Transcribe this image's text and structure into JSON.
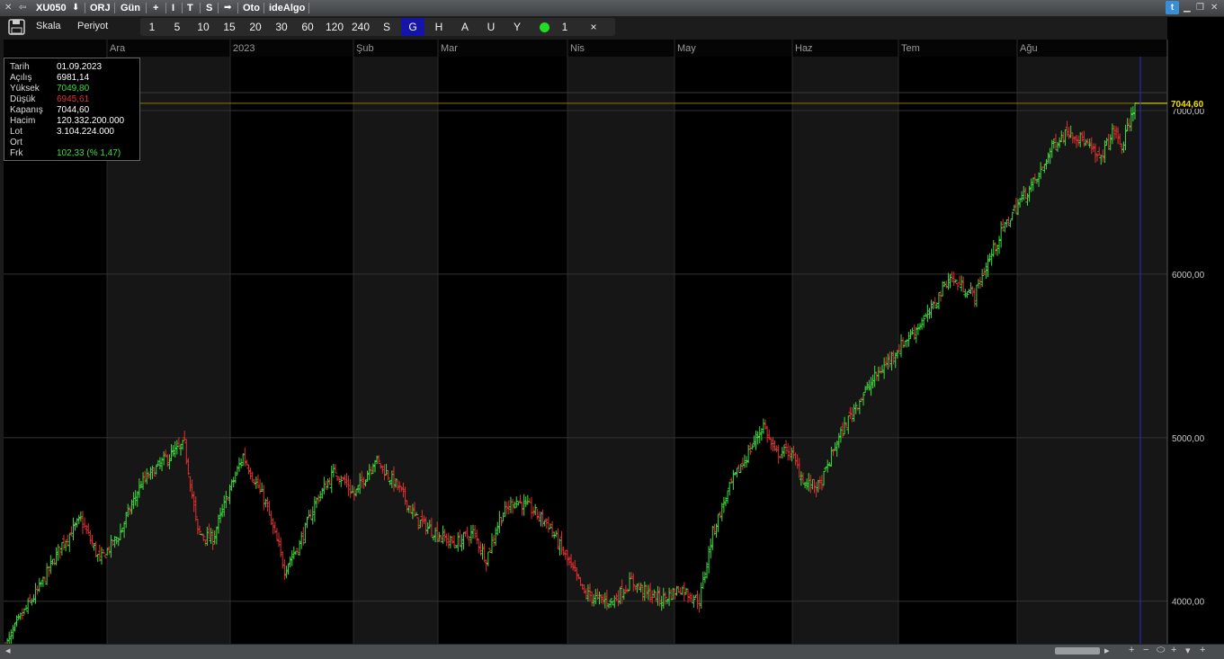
{
  "titlebar": {
    "symbol": "XU050",
    "items": [
      "ORJ",
      "Gün",
      "+",
      "I",
      "T",
      "S",
      "Oto",
      "ideAlgo"
    ]
  },
  "toolbar": {
    "scale_label": "Skala",
    "period_label": "Periyot",
    "periods": [
      "1",
      "5",
      "10",
      "15",
      "20",
      "30",
      "60",
      "120",
      "240",
      "S",
      "G",
      "H",
      "A",
      "U",
      "Y"
    ],
    "active_period": "G",
    "indicator_count": "1",
    "close_label": "×"
  },
  "colors": {
    "up": "#3ddc3d",
    "down": "#e03030",
    "last_price_bg": "#f0e000",
    "cursor_line": "#2a2ad6",
    "grid": "#333333",
    "band": "#161616"
  },
  "icons": [
    "floppy-icon",
    "arrow-left-icon",
    "arrow-down-icon",
    "arrow-right-icon",
    "twitter-icon",
    "minimize-icon",
    "restore-icon",
    "close-icon",
    "zoom-icon"
  ],
  "info_panel": {
    "rows": [
      {
        "label": "Tarih",
        "value": "01.09.2023",
        "color": "#ffffff"
      },
      {
        "label": "Açılış",
        "value": "6981,14",
        "color": "#ffffff"
      },
      {
        "label": "Yüksek",
        "value": "7049,80",
        "color": "#3ddc3d"
      },
      {
        "label": "Düşük",
        "value": "6945,61",
        "color": "#e03030"
      },
      {
        "label": "Kapanış",
        "value": "7044,60",
        "color": "#ffffff"
      },
      {
        "label": "Hacim",
        "value": "120.332.200.000",
        "color": "#ffffff"
      },
      {
        "label": "Lot",
        "value": "3.104.224.000",
        "color": "#ffffff"
      },
      {
        "label": "Ort",
        "value": "",
        "color": "#ffffff"
      },
      {
        "label": "Frk",
        "value": "102,33 (% 1,47)",
        "color": "#3ddc3d"
      }
    ]
  },
  "chart_data": {
    "type": "ohlc",
    "y_ticks": [
      "4000,00",
      "5000,00",
      "6000,00",
      "7000,00"
    ],
    "y_tick_values": [
      4000,
      5000,
      6000,
      7000
    ],
    "last_price": "7044,60",
    "ylim": [
      3740,
      7330
    ],
    "months": [
      "Ara",
      "2023",
      "Şub",
      "Mar",
      "Nis",
      "May",
      "Haz",
      "Tem",
      "Ağu"
    ],
    "grid": true,
    "anchors": [
      [
        0,
        3720
      ],
      [
        8,
        3900
      ],
      [
        18,
        4080
      ],
      [
        30,
        4350
      ],
      [
        40,
        4500
      ],
      [
        50,
        4250
      ],
      [
        60,
        4400
      ],
      [
        72,
        4720
      ],
      [
        85,
        4870
      ],
      [
        95,
        4960
      ],
      [
        102,
        4420
      ],
      [
        110,
        4380
      ],
      [
        118,
        4650
      ],
      [
        126,
        4890
      ],
      [
        138,
        4600
      ],
      [
        148,
        4200
      ],
      [
        156,
        4350
      ],
      [
        165,
        4620
      ],
      [
        175,
        4800
      ],
      [
        185,
        4650
      ],
      [
        196,
        4870
      ],
      [
        208,
        4700
      ],
      [
        218,
        4500
      ],
      [
        228,
        4420
      ],
      [
        238,
        4350
      ],
      [
        248,
        4420
      ],
      [
        255,
        4260
      ],
      [
        262,
        4500
      ],
      [
        270,
        4620
      ],
      [
        278,
        4570
      ],
      [
        288,
        4470
      ],
      [
        298,
        4250
      ],
      [
        307,
        4050
      ],
      [
        315,
        4010
      ],
      [
        322,
        4000
      ],
      [
        332,
        4120
      ],
      [
        340,
        4050
      ],
      [
        348,
        4010
      ],
      [
        358,
        4080
      ],
      [
        368,
        4000
      ],
      [
        375,
        4420
      ],
      [
        385,
        4720
      ],
      [
        395,
        4930
      ],
      [
        402,
        5080
      ],
      [
        408,
        4900
      ],
      [
        416,
        4920
      ],
      [
        424,
        4720
      ],
      [
        432,
        4700
      ],
      [
        440,
        4950
      ],
      [
        450,
        5180
      ],
      [
        460,
        5350
      ],
      [
        470,
        5500
      ],
      [
        480,
        5630
      ],
      [
        490,
        5760
      ],
      [
        500,
        5980
      ],
      [
        508,
        5920
      ],
      [
        514,
        5870
      ],
      [
        520,
        6050
      ],
      [
        528,
        6250
      ],
      [
        538,
        6450
      ],
      [
        548,
        6600
      ],
      [
        556,
        6800
      ],
      [
        564,
        6880
      ],
      [
        572,
        6810
      ],
      [
        580,
        6700
      ],
      [
        588,
        6880
      ],
      [
        592,
        6770
      ],
      [
        599,
        7040
      ]
    ]
  },
  "scroll": {
    "left_arrow": "◂",
    "right_arrow": "▸",
    "controls": [
      "+",
      "−",
      "⬭",
      "+",
      "▾",
      "+"
    ]
  }
}
